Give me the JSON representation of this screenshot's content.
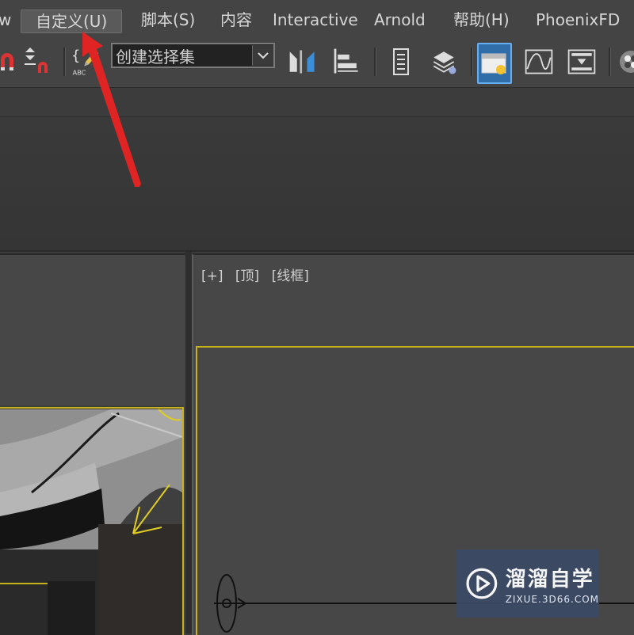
{
  "menubar": {
    "items": [
      {
        "label": "w"
      },
      {
        "label": "自定义(U)"
      },
      {
        "label": "脚本(S)"
      },
      {
        "label": "内容"
      },
      {
        "label": "Interactive"
      },
      {
        "label": "Arnold"
      },
      {
        "label": "帮助(H)"
      },
      {
        "label": "PhoenixFD"
      }
    ],
    "selected_index": 1
  },
  "toolbar": {
    "selection_set_value": "创建选择集",
    "icons": [
      "magnet-icon",
      "snap-spinner-icon",
      "edit-named-selection-icon",
      "mirror-icon",
      "align-icon",
      "layer-manager-icon",
      "scene-explorer-icon",
      "toggle-ribbon-icon",
      "curve-editor-icon",
      "schematic-view-icon",
      "material-editor-icon"
    ]
  },
  "viewport_right": {
    "label_plus": "[+]",
    "label_view": "[顶]",
    "label_shading": "[线框]"
  },
  "watermark": {
    "title": "溜溜自学",
    "url": "ZIXUE.3D66.COM"
  },
  "colors": {
    "menu_bg": "#444444",
    "viewport_bg": "#474747",
    "active_outline": "#c7b21c",
    "annotation_arrow": "#e02424",
    "toolbar_active": "#2f6ea8"
  }
}
